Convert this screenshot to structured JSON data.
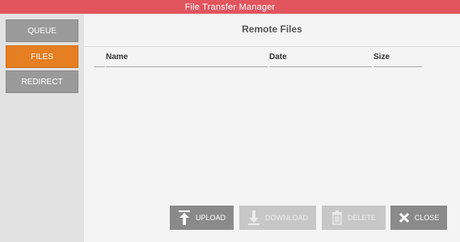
{
  "window": {
    "title": "File Transfer Manager"
  },
  "sidebar": {
    "items": [
      {
        "label": "QUEUE",
        "active": false
      },
      {
        "label": "FILES",
        "active": true
      },
      {
        "label": "REDIRECT",
        "active": false
      }
    ]
  },
  "panel": {
    "title": "Remote Files",
    "columns": [
      "Name",
      "Date",
      "Size"
    ]
  },
  "actions": {
    "upload": "UPLOAD",
    "download": "DOWNLOAD",
    "delete": "DELETE",
    "close": "CLOSE"
  },
  "colors": {
    "titlebar": "#e2545e",
    "active_nav": "#e67e22",
    "inactive_nav": "#9a9a9a",
    "button_enabled": "#8a8a8a",
    "button_disabled": "#c7c7c7"
  }
}
